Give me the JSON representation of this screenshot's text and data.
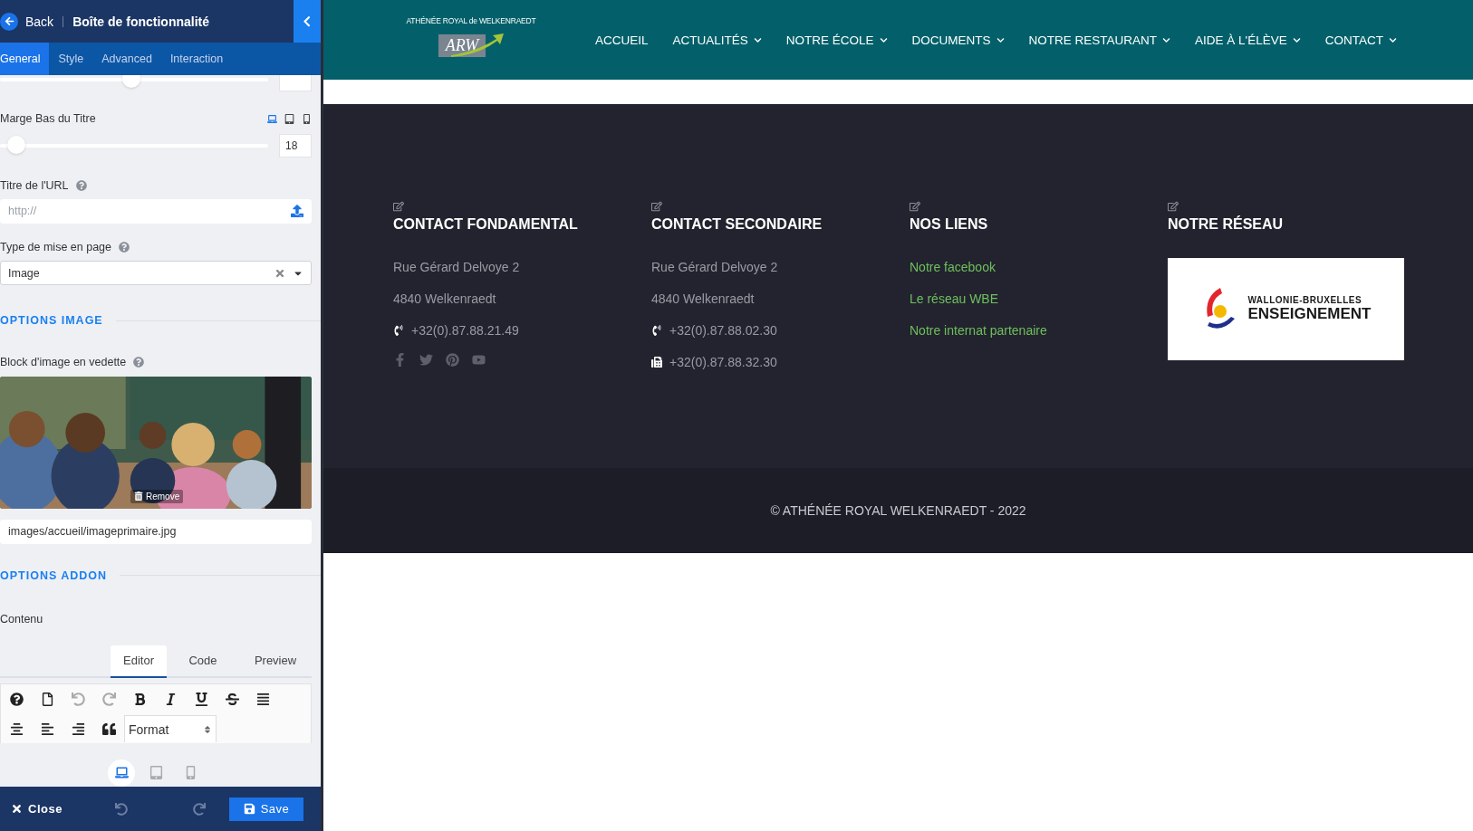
{
  "editor": {
    "header": {
      "back": "Back",
      "title": "Boîte de fonctionnalité"
    },
    "tabs": [
      {
        "label": "General",
        "selected": true
      },
      {
        "label": "Style",
        "selected": false
      },
      {
        "label": "Advanced",
        "selected": false
      },
      {
        "label": "Interaction",
        "selected": false
      }
    ],
    "fields": [
      {
        "kind": "slider",
        "level": 0.49
      },
      {
        "kind": "slider",
        "label": "Marge Bas du Titre",
        "level": 0.06,
        "value": "18",
        "devices": [
          {
            "kind": "desktop",
            "selected": true
          },
          {
            "kind": "tablet",
            "selected": false
          },
          {
            "kind": "mobile",
            "selected": false
          }
        ]
      },
      {
        "kind": "text",
        "label": "Titre de l'URL",
        "help": true,
        "placeholder": "http://"
      },
      {
        "kind": "select",
        "label": "Type de mise en page",
        "help": true,
        "value": "Image"
      },
      {
        "kind": "section",
        "label": "OPTIONS IMAGE"
      },
      {
        "label": "Block d'image en vedette",
        "help": true,
        "remove": "Remove",
        "path": "images/accueil/imageprimaire.jpg"
      },
      {
        "kind": "section",
        "label": "OPTIONS ADDON"
      },
      {
        "kind": "editor",
        "label": "Contenu",
        "tabs": [
          {
            "label": "Editor",
            "selected": true
          },
          {
            "label": "Code",
            "selected": false
          },
          {
            "label": "Preview",
            "selected": false
          }
        ],
        "format": "Format"
      }
    ],
    "devices": [
      {
        "kind": "desktop",
        "selected": true
      },
      {
        "kind": "tablet",
        "selected": false
      },
      {
        "kind": "mobile",
        "selected": false
      }
    ],
    "footer": {
      "close": "Close",
      "save": "Save"
    }
  },
  "site": {
    "logo": {
      "caption": "ATHÉNÉE ROYAL de WELKENRAEDT",
      "mark": "ARW"
    },
    "nav": [
      {
        "label": "ACCUEIL",
        "dropdown": false
      },
      {
        "label": "ACTUALITÉS",
        "dropdown": true
      },
      {
        "label": "NOTRE ÉCOLE",
        "dropdown": true
      },
      {
        "label": "DOCUMENTS",
        "dropdown": true
      },
      {
        "label": "NOTRE RESTAURANT",
        "dropdown": true
      },
      {
        "label": "AIDE À L'ÉLÈVE",
        "dropdown": true
      },
      {
        "label": "CONTACT",
        "dropdown": true
      }
    ],
    "columns": [
      {
        "kind": "contact",
        "title": "CONTACT FONDAMENTAL",
        "lines": [
          {
            "kind": "text",
            "text": "Rue Gérard Delvoye 2"
          },
          {
            "kind": "text",
            "text": "4840 Welkenraedt"
          },
          {
            "kind": "phone",
            "text": "+32(0).87.88.21.49"
          }
        ],
        "social": [
          {
            "kind": "facebook"
          },
          {
            "kind": "twitter"
          },
          {
            "kind": "pinterest"
          },
          {
            "kind": "youtube"
          }
        ]
      },
      {
        "kind": "contact",
        "title": "CONTACT SECONDAIRE",
        "lines": [
          {
            "kind": "text",
            "text": "Rue Gérard Delvoye 2"
          },
          {
            "kind": "text",
            "text": "4840 Welkenraedt"
          },
          {
            "kind": "phone",
            "text": "+32(0).87.88.02.30"
          },
          {
            "kind": "fax",
            "text": "+32(0).87.88.32.30"
          }
        ]
      },
      {
        "kind": "links",
        "title": "NOS LIENS",
        "links": [
          "Notre facebook",
          "Le réseau WBE",
          "Notre internat partenaire"
        ]
      },
      {
        "kind": "network",
        "title": "NOTRE RÉSEAU",
        "logo": {
          "line1": "WALLONIE-BRUXELLES",
          "line2": "ENSEIGNEMENT"
        }
      }
    ],
    "copyright": "© ATHÉNÉE ROYAL WELKENRAEDT - 2022"
  }
}
